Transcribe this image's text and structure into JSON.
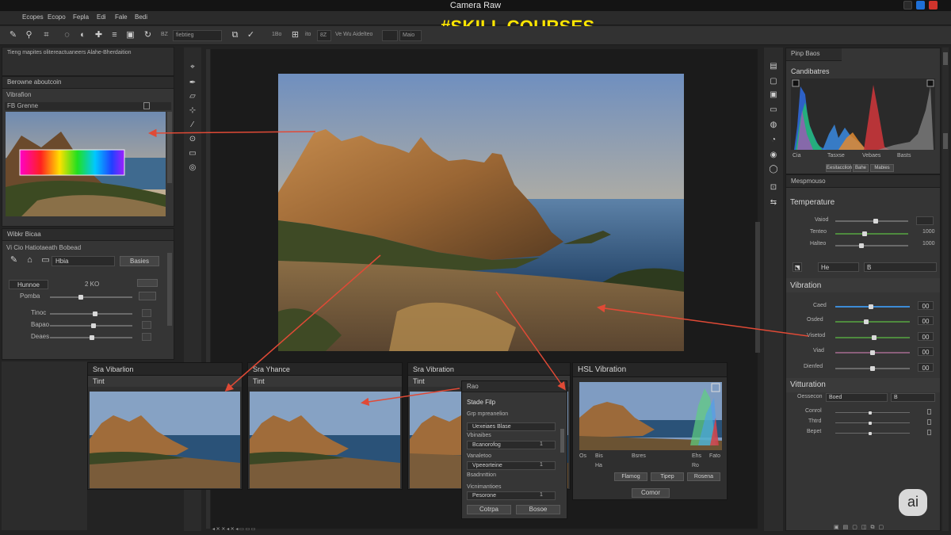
{
  "window": {
    "title": "Camera Raw"
  },
  "watermark": "#SKILL COURSES",
  "menu": [
    "Ecopes",
    "Ecopo",
    "Fepla",
    "Edi",
    "Fale",
    "Bedi"
  ],
  "options": {
    "field_a": "BZ",
    "field_b": "fiebtieg",
    "field_c": "1Bo",
    "field_d": "ito",
    "field_e": "8Z",
    "field_f": "Ve Wu Aidelteo",
    "field_g": "Maio"
  },
  "left": {
    "top_label": "Tieng mapites olitereactuaneers Alahe-Bherdaition",
    "panel1_tab": "Berowne aboutcoin",
    "panel1_sub": "Vibrafion",
    "panel1_row": "FB Grenne",
    "panel2_tab": "Wibkr Bicaa",
    "panel2_sub": "Vi Cio Hatiotaeath Bobead",
    "panel2_field": "Hbia",
    "panel2_btn": "Basies",
    "hunno": "Hunnoe",
    "hunno_val": "2 KO",
    "pomba": "Pomba",
    "sliders": [
      "Tinoc",
      "Bapao",
      "Deaes"
    ]
  },
  "bottom_windows": [
    {
      "title": "Sra Vibarlion",
      "bar": "Tint"
    },
    {
      "title": "Sra Yhance",
      "bar": "Tint"
    },
    {
      "title": "Sra Vibration",
      "bar": "Tint"
    }
  ],
  "popup": {
    "tab": "Rao",
    "title": "Stade Filp",
    "section1": "Grp mpreanelion",
    "dd1": "Uexeiaes Blase",
    "section2": "Vbinaibes",
    "dd2": "Bcanorofog",
    "dd2_val": "1",
    "section3": "Vanaletoo",
    "dd3": "Vpeeorteine",
    "dd3_val": "1",
    "section4": "Bsadnnttion",
    "section5": "Vicnimantioes",
    "dd5": "Pesorone",
    "dd5_val": "1",
    "btn_ok": "Cotrpa",
    "btn_cancel": "Bosoe"
  },
  "hsl": {
    "title": "HSL Vibration",
    "labels": [
      "Os",
      "Bis",
      "Bsres",
      "Ehs",
      "Fato"
    ],
    "row2": [
      "Ha",
      "Ro"
    ],
    "buttons": [
      "Flamog",
      "Tipep",
      "Rosena"
    ],
    "bottom_btn": "Comor"
  },
  "right": {
    "tab": "Pinp Baos",
    "histogram_title": "Candibatres",
    "hist_labels": [
      "Cia",
      "Tasxse",
      "Vebaes",
      "Basts"
    ],
    "hist_btns": [
      "Eesitacclion",
      "Bahe",
      "Mabies"
    ],
    "panel_tab": "Mespmouso",
    "temperature": {
      "title": "Temperature",
      "rows": [
        {
          "label": "Vaiod",
          "val": ""
        },
        {
          "label": "Tenteo",
          "val": "1000"
        },
        {
          "label": "Halteo",
          "val": "1000"
        }
      ]
    },
    "temp_fields": [
      "He",
      "B"
    ],
    "vibration": {
      "title": "Vibration",
      "rows": [
        {
          "label": "Caed",
          "val": "00"
        },
        {
          "label": "Osded",
          "val": "00"
        },
        {
          "label": "Visetod",
          "val": "00"
        },
        {
          "label": "Viad",
          "val": "00"
        },
        {
          "label": "Dienfed",
          "val": "00"
        }
      ]
    },
    "vitturation": {
      "title": "Vitturation",
      "field_label": "Oessecon",
      "field_value": "Boed",
      "field_icon": "B",
      "rows": [
        "Conrol",
        "Thtrd",
        "Bepet"
      ]
    }
  },
  "logo": "ai",
  "colors": {
    "watermark": "#ffe600",
    "arrow": "#e04a36",
    "accent_blue": "#3d8bd6",
    "panel": "#353535"
  }
}
